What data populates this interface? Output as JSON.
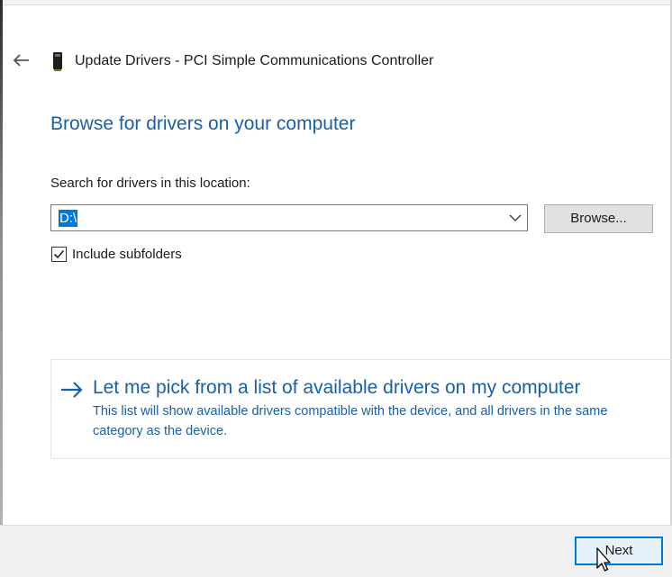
{
  "window": {
    "title": "Update Drivers - PCI Simple Communications Controller"
  },
  "icons": {
    "back": "back-arrow-icon",
    "device": "device-icon",
    "dropdown": "chevron-down-icon",
    "checkmark": "checkmark-icon",
    "link_arrow": "right-arrow-icon",
    "cursor": "mouse-pointer-icon"
  },
  "main": {
    "heading": "Browse for drivers on your computer",
    "search_label": "Search for drivers in this location:",
    "location_value": "D:\\",
    "browse_label": "Browse...",
    "include_subfolders_label": "Include subfolders",
    "include_subfolders_checked": true
  },
  "pick_option": {
    "title": "Let me pick from a list of available drivers on my computer",
    "description": "This list will show available drivers compatible with the device, and all drivers in the same category as the device."
  },
  "footer": {
    "next_label": "Next"
  },
  "colors": {
    "accent": "#1a5fa8",
    "selection": "#0078d7",
    "footer_bg": "#f0f0f0"
  }
}
